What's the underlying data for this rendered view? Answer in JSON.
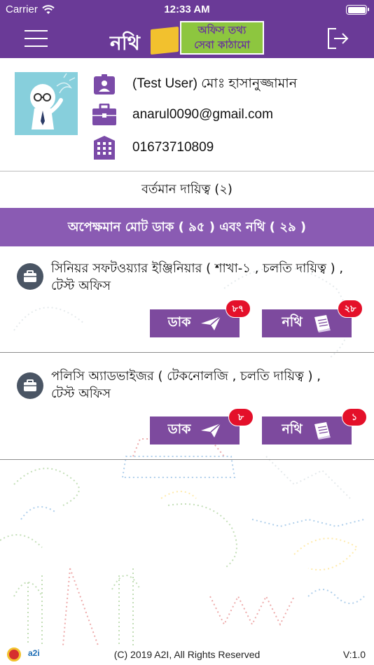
{
  "status_bar": {
    "carrier": "Carrier",
    "time": "12:33 AM"
  },
  "nav": {
    "logo_text": "নথি",
    "logo_tagline_1": "অফিস তথ্য",
    "logo_tagline_2": "সেবা কাঠামো"
  },
  "profile": {
    "name": "(Test User) মোঃ হাসানুজ্জামান",
    "email": "anarul0090@gmail.com",
    "phone": "01673710809"
  },
  "current_responsibility": "বর্তমান দায়িত্ব (২)",
  "pending_summary": "অপেক্ষমান মোট ডাক ( ৯৫ ) এবং নথি ( ২৯ )",
  "designations": [
    {
      "title": "সিনিয়র সফটওয়্যার ইঞ্জিনিয়ার ( শাখা-১ , চলতি দায়িত্ব ) , টেস্ট অফিস",
      "dak_label": "ডাক",
      "dak_count": "৮৭",
      "nothi_label": "নথি",
      "nothi_count": "২৮"
    },
    {
      "title": "পলিসি অ্যাডভাইজর ( টেকনোলজি , চলতি দায়িত্ব ) , টেস্ট অফিস",
      "dak_label": "ডাক",
      "dak_count": "৮",
      "nothi_label": "নথি",
      "nothi_count": "১"
    }
  ],
  "footer": {
    "copyright": "(C) 2019 A2I, All Rights Reserved",
    "version": "V:1.0",
    "a2i_logo": "a2i"
  },
  "colors": {
    "brand": "#6a3a97",
    "banner": "#8a5bb3",
    "button": "#7d4a9e",
    "badge": "#e4102a"
  },
  "icons": [
    "wifi-icon",
    "battery-icon",
    "menu-icon",
    "logout-icon",
    "id-card-icon",
    "briefcase-icon",
    "building-icon",
    "bag-icon",
    "send-icon",
    "file-icon"
  ]
}
